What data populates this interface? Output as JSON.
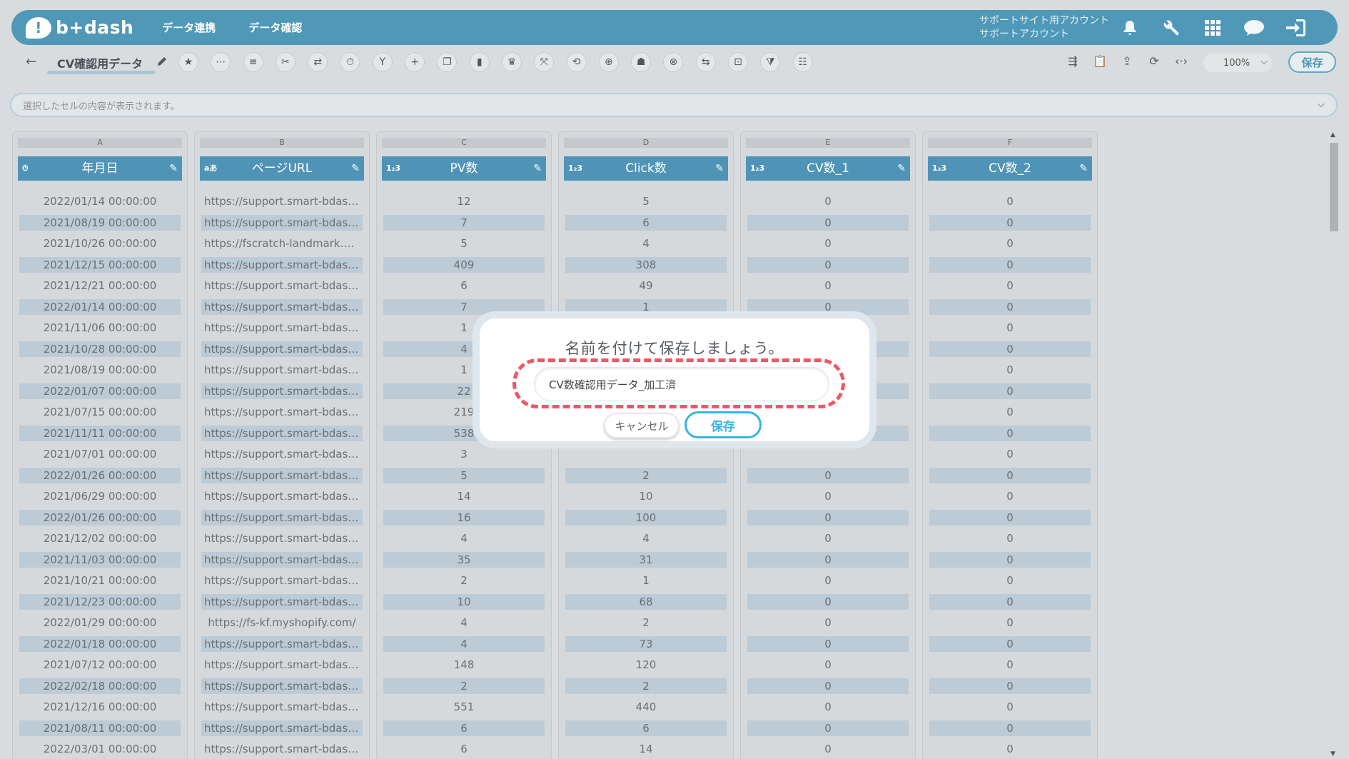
{
  "header": {
    "logo_text": "b+dash",
    "nav": [
      "データ連携",
      "データ確認"
    ],
    "account_line1": "サポートサイト用アカウント",
    "account_line2": "サポートアカウント",
    "icons": [
      "bell-icon",
      "wrench-icon",
      "apps-grid-icon",
      "chat-icon",
      "logout-icon"
    ]
  },
  "toolbar": {
    "back_symbol": "←",
    "sheet_name": "CV確認用データ",
    "zoom": "100%",
    "save_label": "保存",
    "tools": [
      "★",
      "⋯",
      "≡",
      "✂",
      "⇄",
      "⏱",
      "Y",
      "+",
      "❐",
      "▮",
      "♛",
      "⤧",
      "⟲",
      "⊕",
      "☗",
      "⊗",
      "⇆",
      "⊡",
      "⧩",
      "☷"
    ],
    "right_tools": [
      "⇶",
      "📋",
      "⇪",
      "⟳",
      "‹·›"
    ]
  },
  "formula_bar": {
    "placeholder": "選択したセルの内容が表示されます。"
  },
  "columns": [
    {
      "letter": "A",
      "name": "年月日",
      "type": "⏱"
    },
    {
      "letter": "B",
      "name": "ページURL",
      "type": "aあ"
    },
    {
      "letter": "C",
      "name": "PV数",
      "type": "1₂3"
    },
    {
      "letter": "D",
      "name": "Click数",
      "type": "1₂3"
    },
    {
      "letter": "E",
      "name": "CV数_1",
      "type": "1₂3"
    },
    {
      "letter": "F",
      "name": "CV数_2",
      "type": "1₂3"
    }
  ],
  "rows": [
    [
      "2022/01/14 00:00:00",
      "https://support.smart-bdash...",
      "12",
      "5",
      "0",
      "0"
    ],
    [
      "2021/08/19 00:00:00",
      "https://support.smart-bdash...",
      "7",
      "6",
      "0",
      "0"
    ],
    [
      "2021/10/26 00:00:00",
      "https://fscratch-landmark.co...",
      "5",
      "4",
      "0",
      "0"
    ],
    [
      "2021/12/15 00:00:00",
      "https://support.smart-bdash...",
      "409",
      "308",
      "0",
      "0"
    ],
    [
      "2021/12/21 00:00:00",
      "https://support.smart-bdash...",
      "6",
      "49",
      "0",
      "0"
    ],
    [
      "2022/01/14 00:00:00",
      "https://support.smart-bdash...",
      "7",
      "1",
      "0",
      "0"
    ],
    [
      "2021/11/06 00:00:00",
      "https://support.smart-bdash...",
      "1",
      "",
      "",
      "0"
    ],
    [
      "2021/10/28 00:00:00",
      "https://support.smart-bdash...",
      "4",
      "",
      "",
      "0"
    ],
    [
      "2021/08/19 00:00:00",
      "https://support.smart-bdash...",
      "1",
      "",
      "",
      "0"
    ],
    [
      "2022/01/07 00:00:00",
      "https://support.smart-bdash...",
      "22",
      "",
      "",
      "0"
    ],
    [
      "2021/07/15 00:00:00",
      "https://support.smart-bdash...",
      "219",
      "",
      "",
      "0"
    ],
    [
      "2021/11/11 00:00:00",
      "https://support.smart-bdash...",
      "538",
      "",
      "",
      "0"
    ],
    [
      "2021/07/01 00:00:00",
      "https://support.smart-bdash...",
      "3",
      "",
      "",
      "0"
    ],
    [
      "2022/01/26 00:00:00",
      "https://support.smart-bdash...",
      "5",
      "2",
      "0",
      "0"
    ],
    [
      "2021/06/29 00:00:00",
      "https://support.smart-bdash...",
      "14",
      "10",
      "0",
      "0"
    ],
    [
      "2022/01/26 00:00:00",
      "https://support.smart-bdash...",
      "16",
      "100",
      "0",
      "0"
    ],
    [
      "2021/12/02 00:00:00",
      "https://support.smart-bdash...",
      "4",
      "4",
      "0",
      "0"
    ],
    [
      "2021/11/03 00:00:00",
      "https://support.smart-bdash...",
      "35",
      "31",
      "0",
      "0"
    ],
    [
      "2021/10/21 00:00:00",
      "https://support.smart-bdash...",
      "2",
      "1",
      "0",
      "0"
    ],
    [
      "2021/12/23 00:00:00",
      "https://support.smart-bdash...",
      "10",
      "68",
      "0",
      "0"
    ],
    [
      "2022/01/29 00:00:00",
      "https://fs-kf.myshopify.com/",
      "4",
      "2",
      "0",
      "0"
    ],
    [
      "2022/01/18 00:00:00",
      "https://support.smart-bdash...",
      "4",
      "73",
      "0",
      "0"
    ],
    [
      "2021/07/12 00:00:00",
      "https://support.smart-bdash...",
      "148",
      "120",
      "0",
      "0"
    ],
    [
      "2022/02/18 00:00:00",
      "https://support.smart-bdash...",
      "2",
      "2",
      "0",
      "0"
    ],
    [
      "2021/12/16 00:00:00",
      "https://support.smart-bdash...",
      "551",
      "440",
      "0",
      "0"
    ],
    [
      "2021/08/11 00:00:00",
      "https://support.smart-bdash...",
      "6",
      "6",
      "0",
      "0"
    ],
    [
      "2022/03/01 00:00:00",
      "https://support.smart-bdash...",
      "6",
      "14",
      "0",
      "0"
    ]
  ],
  "modal": {
    "title": "名前を付けて保存しましょう。",
    "input_value": "CV数確認用データ_加工済",
    "cancel_label": "キャンセル",
    "save_label": "保存",
    "highlight_color": "#ee5766"
  },
  "colors": {
    "header_bg": "#4f98b7",
    "column_header_bg": "#4f94b7",
    "alt_row_bg": "#bccbd6",
    "save_accent": "#38b3e3"
  }
}
